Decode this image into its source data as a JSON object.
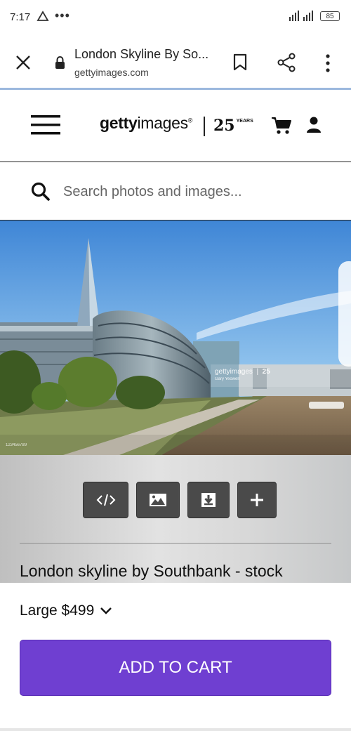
{
  "status_bar": {
    "time": "7:17",
    "battery": "85"
  },
  "browser": {
    "page_title": "London Skyline By So...",
    "url": "gettyimages.com"
  },
  "header": {
    "logo_bold": "getty",
    "logo_light": "images",
    "logo_mark": "®",
    "anniversary_number": "25",
    "anniversary_label": "YEARS"
  },
  "search": {
    "placeholder": "Search photos and images..."
  },
  "image": {
    "watermark_brand": "gettyimages",
    "watermark_years": "25",
    "watermark_credit": "Gary Yeowell",
    "credit_id": "123456789"
  },
  "toolbar": {
    "buttons": [
      {
        "icon": "embed-code-icon"
      },
      {
        "icon": "image-icon"
      },
      {
        "icon": "download-icon"
      },
      {
        "icon": "plus-icon"
      }
    ]
  },
  "asset": {
    "title": "London skyline by Southbank - stock"
  },
  "purchase": {
    "size_label": "Large $499",
    "add_to_cart": "ADD TO CART",
    "accent_color": "#6f3fd1"
  }
}
